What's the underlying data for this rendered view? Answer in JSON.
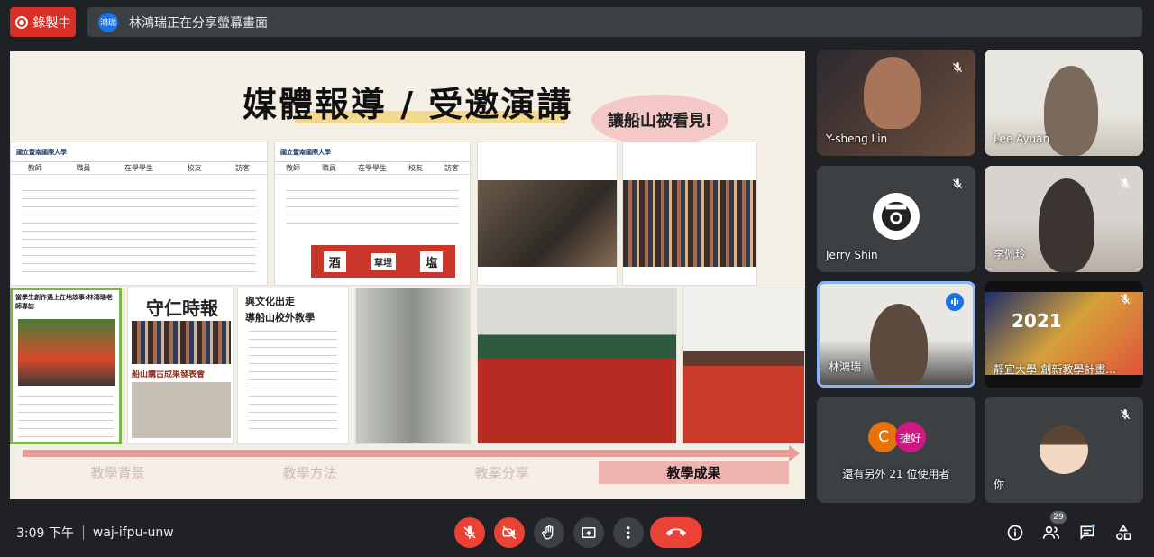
{
  "top_bar": {
    "record_label": "錄製中",
    "share_avatar": "鴻瑞",
    "share_text": "林鴻瑞正在分享螢幕畫面"
  },
  "slide": {
    "title": "媒體報導 / 受邀演講",
    "bubble": "讓船山被看見!",
    "site_name": "國立暨南國際大學",
    "nav": [
      "教師",
      "職員",
      "在學學生",
      "校友",
      "訪客"
    ],
    "article_headline_1": "與文化出走",
    "article_headline_2": "導船山校外教學",
    "newspaper_title": "守仁時報",
    "newspaper_event": "船山講古成果發表會",
    "news_caption": "當學生創作遇上在地故事:林鴻瑞老師專訪",
    "school_sign": [
      "酒",
      "草埕",
      "塩"
    ],
    "steps": [
      "教學背景",
      "教學方法",
      "教案分享",
      "教學成果"
    ]
  },
  "participants": [
    {
      "name": "Y-sheng Lin",
      "muted": true
    },
    {
      "name": "Lee Ayuan",
      "muted": false
    },
    {
      "name": "Jerry Shin",
      "muted": true
    },
    {
      "name": "李佩玲",
      "muted": true
    },
    {
      "name": "林鴻瑞",
      "speaking": true
    },
    {
      "name": "靜宜大學-創新教學計畫...",
      "muted": true,
      "poster_year": "2021"
    },
    {
      "name": "還有另外 21 位使用者",
      "avatars": [
        "C",
        "捷好"
      ]
    },
    {
      "name": "你",
      "muted": true
    }
  ],
  "bottom_bar": {
    "time": "3:09 下午",
    "meeting_code": "waj-ifpu-unw",
    "people_count": "29"
  },
  "colors": {
    "record": "#d93025",
    "end_call": "#ea4335",
    "speaking_border": "#8ab4f8",
    "active_step": "#efb3b0"
  }
}
